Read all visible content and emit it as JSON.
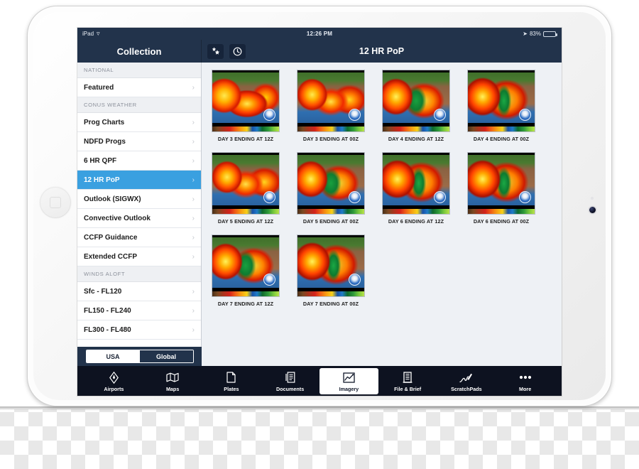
{
  "status_bar": {
    "device_label": "iPad",
    "wifi_icon": "wifi-icon",
    "time": "12:26 PM",
    "location_icon": "location-arrow-icon",
    "battery_percent": "83%",
    "battery_level": 83
  },
  "nav_bar": {
    "sidebar_title": "Collection",
    "title": "12 HR PoP",
    "buttons": [
      {
        "icon": "stars-icon",
        "glyph": "✦"
      },
      {
        "icon": "clock-icon",
        "glyph": "◴"
      }
    ]
  },
  "sidebar": {
    "sections": [
      {
        "header": "NATIONAL",
        "items": [
          {
            "label": "Featured",
            "selected": false
          }
        ]
      },
      {
        "header": "CONUS WEATHER",
        "items": [
          {
            "label": "Prog Charts",
            "selected": false
          },
          {
            "label": "NDFD Progs",
            "selected": false
          },
          {
            "label": "6 HR QPF",
            "selected": false
          },
          {
            "label": "12 HR PoP",
            "selected": true
          },
          {
            "label": "Outlook (SIGWX)",
            "selected": false
          },
          {
            "label": "Convective Outlook",
            "selected": false
          },
          {
            "label": "CCFP Guidance",
            "selected": false
          },
          {
            "label": "Extended CCFP",
            "selected": false
          }
        ]
      },
      {
        "header": "WINDS ALOFT",
        "items": [
          {
            "label": "Sfc - FL120",
            "selected": false
          },
          {
            "label": "FL150 - FL240",
            "selected": false
          },
          {
            "label": "FL300 - FL480",
            "selected": false
          }
        ]
      }
    ],
    "chevron": "›",
    "segmented_control": {
      "options": [
        {
          "label": "USA",
          "active": true
        },
        {
          "label": "Global",
          "active": false
        }
      ]
    }
  },
  "content": {
    "thumbnails": [
      {
        "caption": "DAY 3 ENDING AT 12Z",
        "variant": "v1"
      },
      {
        "caption": "DAY 3 ENDING AT 00Z",
        "variant": "v2"
      },
      {
        "caption": "DAY 4 ENDING AT 12Z",
        "variant": "v3"
      },
      {
        "caption": "DAY 4 ENDING AT 00Z",
        "variant": "v4"
      },
      {
        "caption": "DAY 5 ENDING AT 12Z",
        "variant": "v2"
      },
      {
        "caption": "DAY 5 ENDING AT 00Z",
        "variant": "v3"
      },
      {
        "caption": "DAY 6 ENDING AT 12Z",
        "variant": "v4"
      },
      {
        "caption": "DAY 6 ENDING AT 00Z",
        "variant": "v4"
      },
      {
        "caption": "DAY 7 ENDING AT 12Z",
        "variant": "v3"
      },
      {
        "caption": "DAY 7 ENDING AT 00Z",
        "variant": "v4"
      }
    ]
  },
  "tab_bar": {
    "items": [
      {
        "label": "Airports",
        "icon": "airport-compass-icon",
        "selected": false
      },
      {
        "label": "Maps",
        "icon": "map-fold-icon",
        "selected": false
      },
      {
        "label": "Plates",
        "icon": "plate-page-icon",
        "selected": false
      },
      {
        "label": "Documents",
        "icon": "documents-icon",
        "selected": false
      },
      {
        "label": "Imagery",
        "icon": "imagery-chart-icon",
        "selected": true
      },
      {
        "label": "File & Brief",
        "icon": "file-brief-icon",
        "selected": false
      },
      {
        "label": "ScratchPads",
        "icon": "pen-icon",
        "selected": false
      },
      {
        "label": "More",
        "icon": "ellipsis-icon",
        "selected": false
      }
    ]
  },
  "colors": {
    "nav_background": "#22334b",
    "selected_row": "#3aa0e0",
    "tab_bar_background": "#0d1220",
    "content_background": "#eef1f5",
    "battery_green": "#4cd964"
  }
}
